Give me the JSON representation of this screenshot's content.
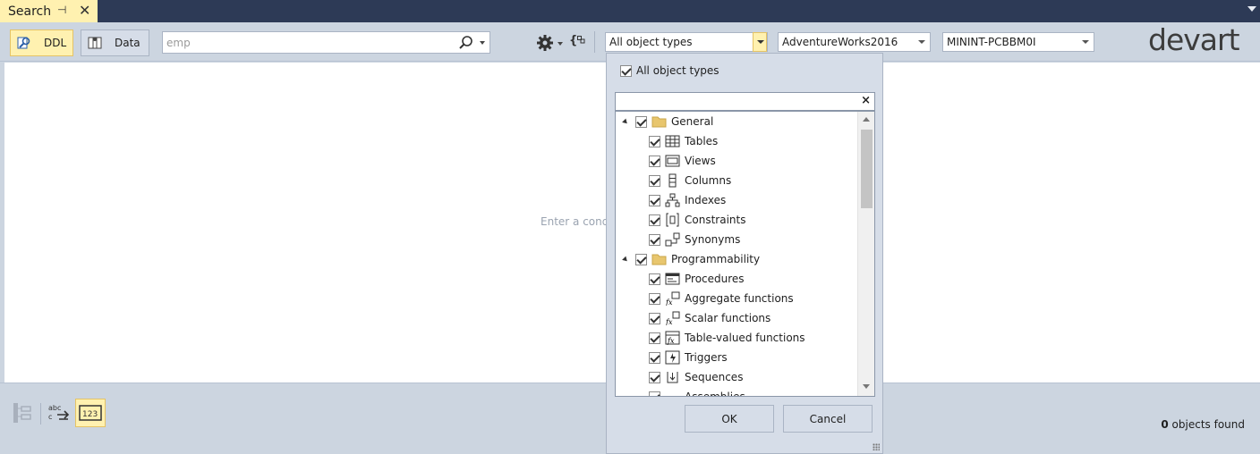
{
  "tab": {
    "title": "Search",
    "pin_glyph": "⊣",
    "close_glyph": "✕"
  },
  "toolbar": {
    "ddl_label": "DDL",
    "data_label": "Data",
    "search_value": "emp",
    "object_types": "All object types",
    "database": "AdventureWorks2016",
    "server": "MININT-PCBBM0I",
    "braces_glyph": "{"
  },
  "logo": "devart",
  "main": {
    "hint": "Enter a cond"
  },
  "popup": {
    "all_label": "All object types",
    "filter_value": "",
    "clear_glyph": "×",
    "tree": [
      {
        "label": "General",
        "level": 0,
        "icon": "folder-icon",
        "checked": true
      },
      {
        "label": "Tables",
        "level": 1,
        "icon": "table-icon",
        "checked": true
      },
      {
        "label": "Views",
        "level": 1,
        "icon": "view-icon",
        "checked": true
      },
      {
        "label": "Columns",
        "level": 1,
        "icon": "column-icon",
        "checked": true
      },
      {
        "label": "Indexes",
        "level": 1,
        "icon": "index-icon",
        "checked": true
      },
      {
        "label": "Constraints",
        "level": 1,
        "icon": "constraint-icon",
        "checked": true
      },
      {
        "label": "Synonyms",
        "level": 1,
        "icon": "synonym-icon",
        "checked": true
      },
      {
        "label": "Programmability",
        "level": 0,
        "icon": "folder-icon",
        "checked": true
      },
      {
        "label": "Procedures",
        "level": 1,
        "icon": "procedure-icon",
        "checked": true
      },
      {
        "label": "Aggregate functions",
        "level": 1,
        "icon": "aggregate-function-icon",
        "checked": true
      },
      {
        "label": "Scalar functions",
        "level": 1,
        "icon": "scalar-function-icon",
        "checked": true
      },
      {
        "label": "Table-valued functions",
        "level": 1,
        "icon": "table-valued-function-icon",
        "checked": true
      },
      {
        "label": "Triggers",
        "level": 1,
        "icon": "trigger-icon",
        "checked": true
      },
      {
        "label": "Sequences",
        "level": 1,
        "icon": "sequence-icon",
        "checked": true
      },
      {
        "label": "Assemblies",
        "level": 1,
        "icon": "assembly-icon",
        "checked": true
      }
    ],
    "ok_label": "OK",
    "cancel_label": "Cancel"
  },
  "bottom": {
    "abc_label": "abc",
    "num_label": "123"
  },
  "status": {
    "count": "0",
    "suffix": " objects found"
  },
  "colors": {
    "accent": "#fff1b0",
    "titlebar": "#2d3a56",
    "chrome": "#ccd5e0"
  }
}
